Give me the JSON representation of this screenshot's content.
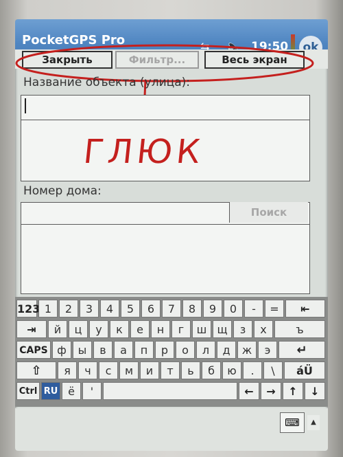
{
  "titlebar": {
    "app_title": "PocketGPS Pro",
    "time": "19:50",
    "ok_label": "ok",
    "connectivity_icon": "⇆",
    "volume_icon": "🔈"
  },
  "toolbar": {
    "close_label": "Закрыть",
    "filter_label": "Фильтр...",
    "fullscreen_label": "Весь экран"
  },
  "form": {
    "object_name_label": "Название объекта (улица):",
    "house_number_label": "Номер дома:",
    "search_label": "Поиск"
  },
  "annotation": {
    "text": "ГЛЮК",
    "color": "#c4201e"
  },
  "keyboard": {
    "row1": [
      "123",
      "1",
      "2",
      "3",
      "4",
      "5",
      "6",
      "7",
      "8",
      "9",
      "0",
      "-",
      "=",
      "⇤"
    ],
    "row2": [
      "⇥",
      "й",
      "ц",
      "у",
      "к",
      "е",
      "н",
      "г",
      "ш",
      "щ",
      "з",
      "х",
      "ъ"
    ],
    "row3": [
      "CAPS",
      "ф",
      "ы",
      "в",
      "а",
      "п",
      "р",
      "о",
      "л",
      "д",
      "ж",
      "э",
      "↵"
    ],
    "row4": [
      "⇧",
      "я",
      "ч",
      "с",
      "м",
      "и",
      "т",
      "ь",
      "б",
      "ю",
      ".",
      "\\",
      "áÜ"
    ],
    "row5": [
      "Ctrl",
      "RU",
      "ё",
      "'",
      "",
      "←",
      "→",
      "↑",
      "↓"
    ]
  },
  "colors": {
    "title_blue": "#4f85c1",
    "screen_bg": "#d8ddd9",
    "ru_key": "#2f5d9e"
  }
}
